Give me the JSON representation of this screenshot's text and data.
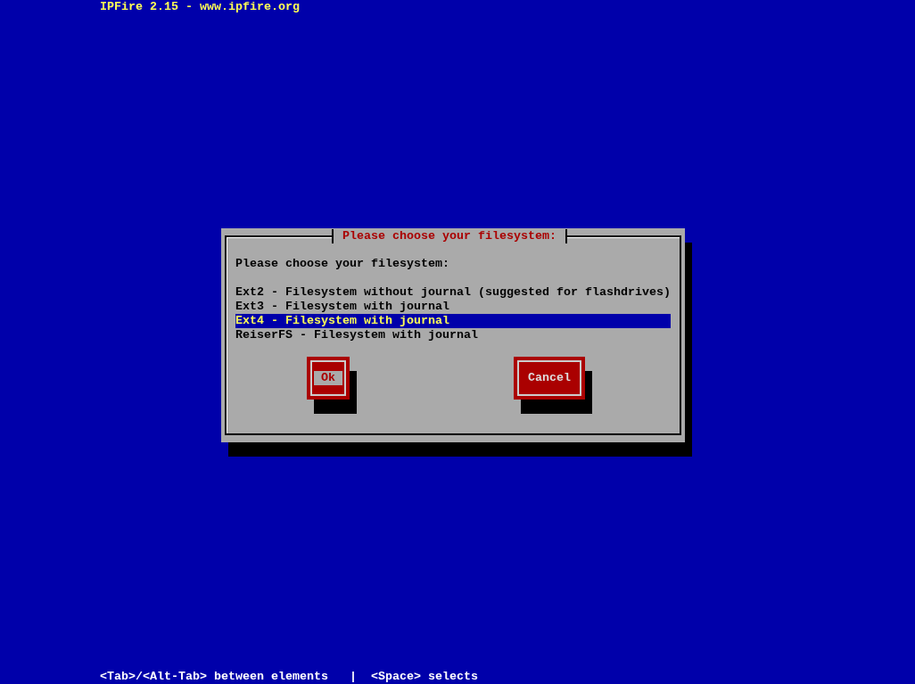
{
  "header": "IPFire 2.15 - www.ipfire.org",
  "dialog": {
    "title": "Please choose your filesystem:",
    "message": "Please choose your filesystem:",
    "options": [
      {
        "label": "Ext2 - Filesystem without journal (suggested for flashdrives)",
        "selected": false
      },
      {
        "label": "Ext3 - Filesystem with journal",
        "selected": false
      },
      {
        "label": "Ext4 - Filesystem with journal",
        "selected": true
      },
      {
        "label": "ReiserFS - Filesystem with journal",
        "selected": false
      }
    ],
    "buttons": [
      {
        "label": "Ok",
        "focused": true
      },
      {
        "label": "Cancel",
        "focused": false
      }
    ]
  },
  "status_bar": "<Tab>/<Alt-Tab> between elements   |  <Space> selects"
}
